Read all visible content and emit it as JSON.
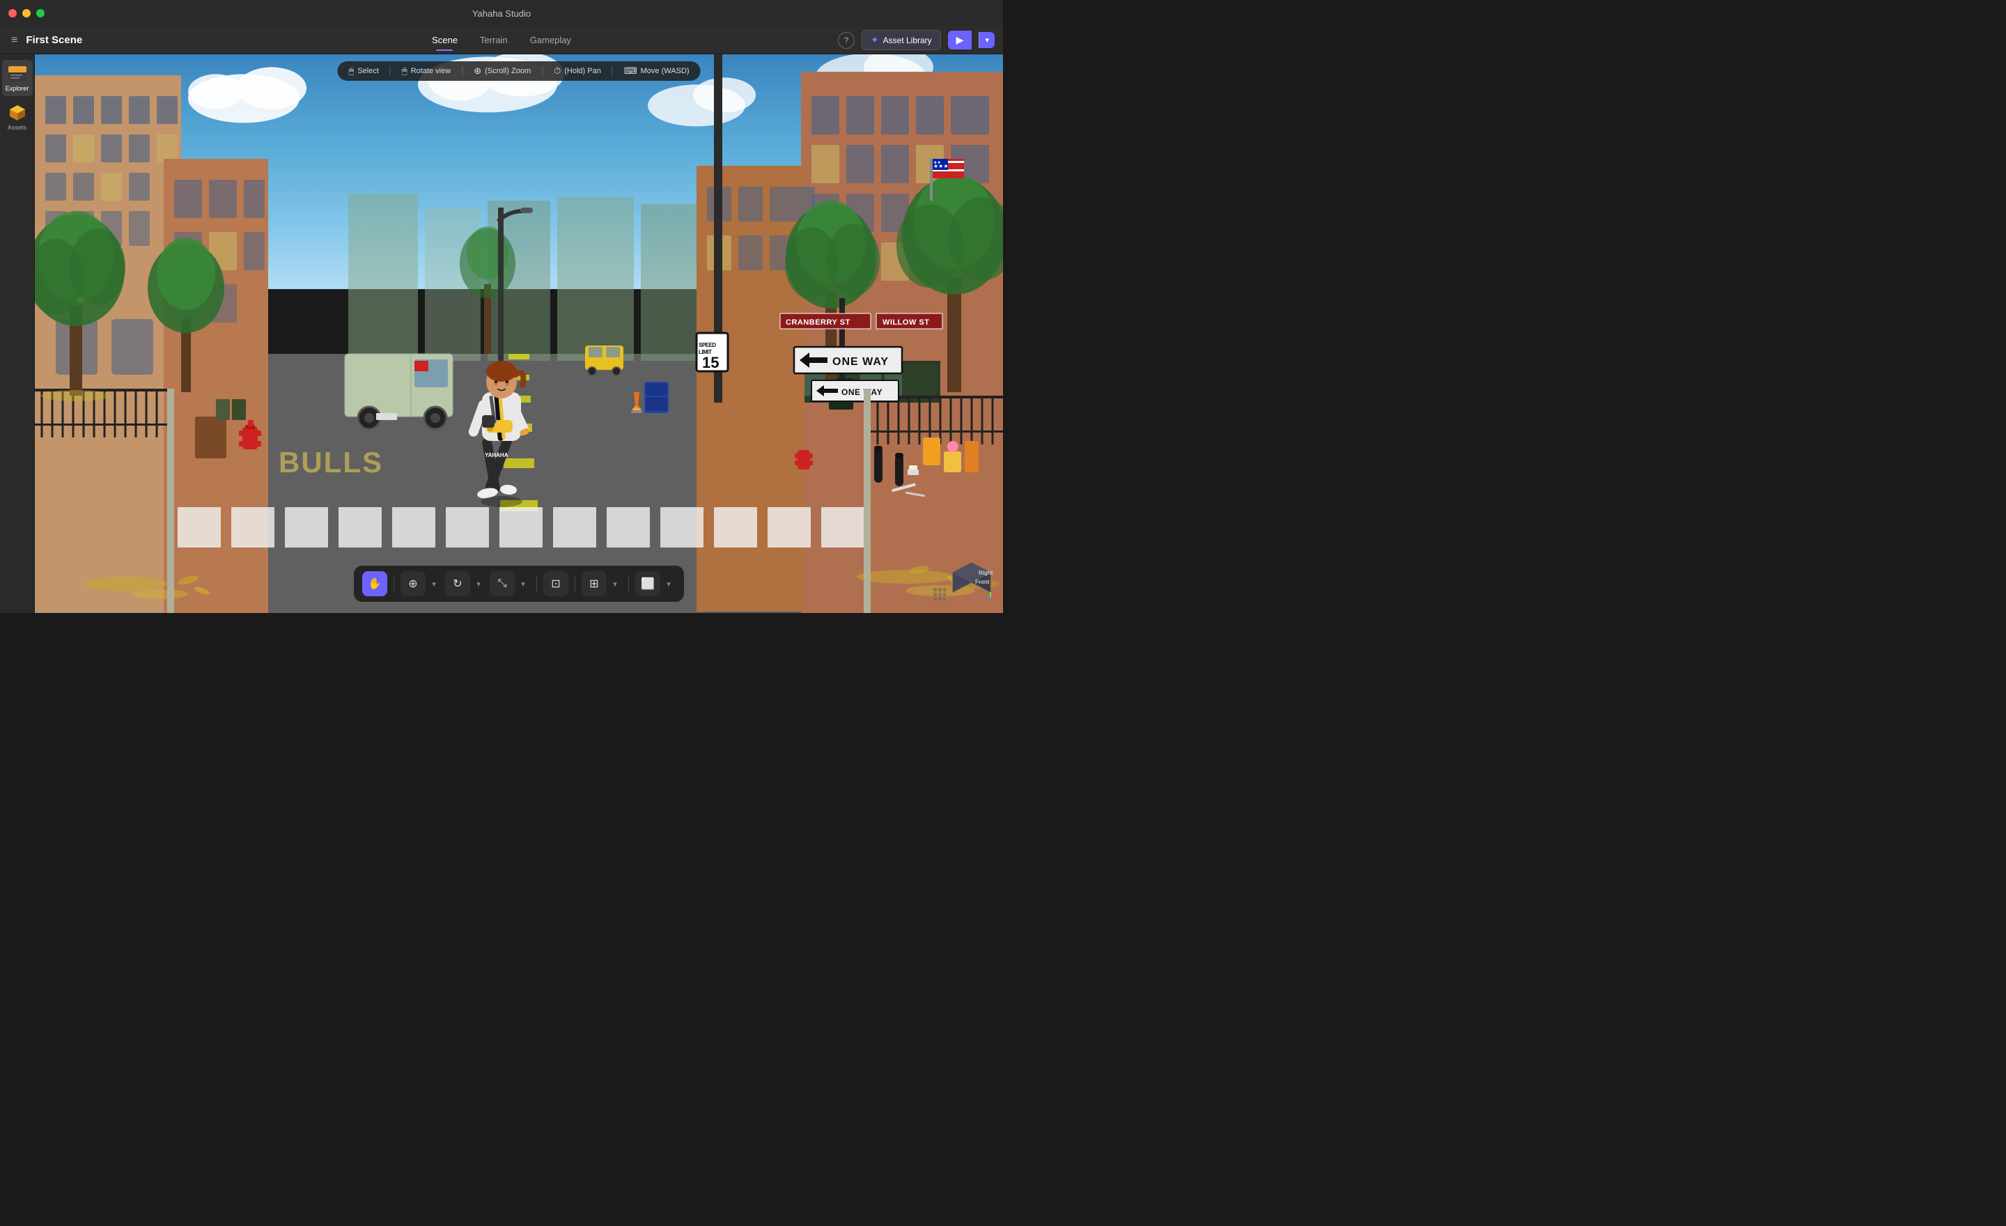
{
  "app": {
    "title": "Yahaha Studio",
    "window_title": "First Scene"
  },
  "window_controls": {
    "close_label": "×",
    "min_label": "−",
    "max_label": "+"
  },
  "header": {
    "hamburger_label": "≡",
    "scene_title": "First Scene",
    "tabs": [
      {
        "id": "scene",
        "label": "Scene",
        "active": true
      },
      {
        "id": "terrain",
        "label": "Terrain",
        "active": false
      },
      {
        "id": "gameplay",
        "label": "Gameplay",
        "active": false
      }
    ],
    "help_label": "?",
    "asset_library_label": "Asset Library",
    "play_label": "▶",
    "play_dropdown_label": "▾"
  },
  "sidebar": {
    "items": [
      {
        "id": "explorer",
        "label": "Explorer",
        "active": true
      },
      {
        "id": "assets",
        "label": "Assets",
        "active": false
      }
    ]
  },
  "viewport": {
    "toolbar_tools": [
      {
        "id": "select",
        "icon": "👆",
        "label": "Select"
      },
      {
        "id": "rotate_view",
        "icon": "🖱",
        "label": "Rotate view"
      },
      {
        "id": "scroll_zoom",
        "icon": "⊕",
        "label": "(Scroll) Zoom"
      },
      {
        "id": "hold_pan",
        "icon": "⏱",
        "label": "(Hold) Pan"
      },
      {
        "id": "move_wasd",
        "icon": "⌨",
        "label": "Move (WASD)"
      }
    ]
  },
  "scene": {
    "street_signs": {
      "one_way_1": "ONE WAY",
      "one_way_2": "ONE WAY",
      "cranberry_st": "CRANBERRY ST",
      "willow_st": "WILLOW ST",
      "speed_limit_label": "SPEED\nLIMIT",
      "speed_limit_value": "15"
    }
  },
  "bottom_toolbar": {
    "buttons": [
      {
        "id": "grab",
        "icon": "✋",
        "label": "Grab",
        "active": true
      },
      {
        "id": "translate",
        "icon": "⊕",
        "label": "Translate",
        "active": false
      },
      {
        "id": "rotate",
        "icon": "↻",
        "label": "Rotate",
        "active": false
      },
      {
        "id": "scale",
        "icon": "⤡",
        "label": "Scale",
        "active": false
      },
      {
        "id": "snap",
        "icon": "⊞",
        "label": "Snap",
        "active": false
      },
      {
        "id": "pivot",
        "icon": "◎",
        "label": "Pivot",
        "active": false
      },
      {
        "id": "grid",
        "icon": "⊞",
        "label": "Grid",
        "active": false
      },
      {
        "id": "camera",
        "icon": "⬜",
        "label": "Camera",
        "active": false
      }
    ]
  },
  "view_cube": {
    "front_label": "Front",
    "right_label": "Right"
  },
  "colors": {
    "accent_purple": "#6c63ff",
    "toolbar_bg": "rgba(30,30,30,0.9)",
    "sign_red": "#cc0000",
    "brick_red": "#8B1A1A"
  }
}
